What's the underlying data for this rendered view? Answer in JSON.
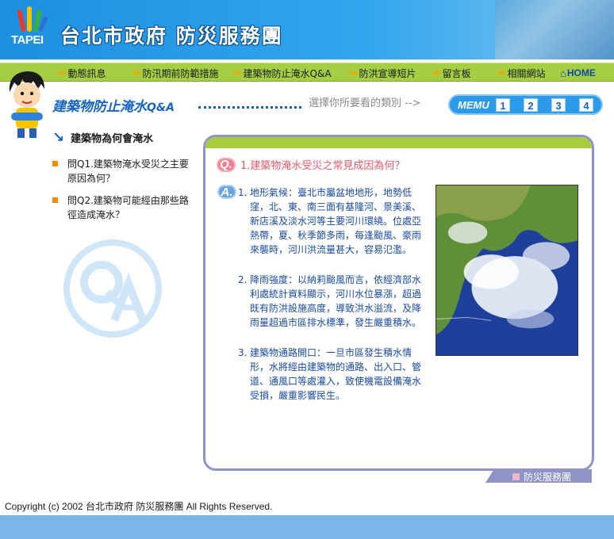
{
  "header": {
    "logo_text": "TAPEI",
    "site_title": "台北市政府  防災服務團"
  },
  "nav": {
    "items": [
      {
        "label": "動態訊息"
      },
      {
        "label": "防汛期前防範措施"
      },
      {
        "label": "建築物防止淹水Q&A"
      },
      {
        "label": "防洪宣導短片"
      },
      {
        "label": "留言板"
      },
      {
        "label": "相關網站"
      }
    ],
    "home_label": "HOME"
  },
  "page": {
    "heading": "建築物防止淹水",
    "heading_suffix": "Q&A",
    "select_hint": "選擇你所要看的類別  -->",
    "menu_label": "MEMU",
    "menu_numbers": [
      "1",
      "2",
      "3",
      "4"
    ]
  },
  "sidebar": {
    "sub_heading": "建築物為何會淹水",
    "questions": [
      {
        "text": "問Q1.建築物淹水受災之主要原因為何？"
      },
      {
        "text": "問Q2.建築物可能經由那些路徑造成淹水？"
      }
    ]
  },
  "content": {
    "question": "1.建築物淹水受災之常見成因為何？",
    "q_badge": "Q.",
    "a_badge": "A.",
    "answers": [
      {
        "num": "1.",
        "text": "地形氣候：臺北市屬盆地地形，地勢低窪，北、東、南三面有基隆河、景美溪、新店溪及淡水河等主要河川環繞。位處亞熱帶，夏、秋季節多雨，每逢颱風、豪雨來襲時，河川洪流量甚大，容易氾濫。"
      },
      {
        "num": "2.",
        "text": "降雨強度：以納莉颱風而言，依經濟部水利處統計資料顯示，河川水位暴漲，超過既有防洪設施高度，導致洪水溢流，及降雨量超過市區排水標準，發生嚴重積水。"
      },
      {
        "num": "3.",
        "text": "建築物通路開口：一旦市區發生積水情形，水將經由建築物的通路、出入口、管道、通風口等處灌入，致使機電設備淹水受損，嚴重影響民生。"
      }
    ],
    "panel_tab": "防災服務團"
  },
  "footer": {
    "copyright": "Copyright (c) 2002 台北市政府 防災服務團 All Rights Reserved."
  }
}
